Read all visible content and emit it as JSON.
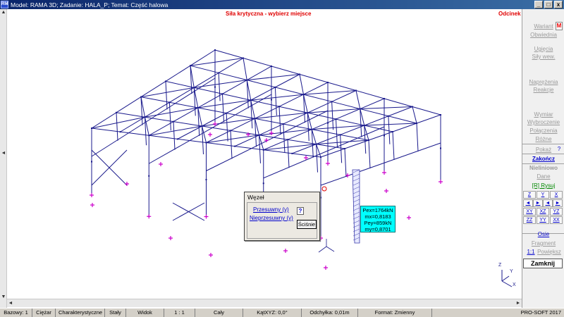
{
  "titlebar": {
    "icon_text": "RM",
    "title": "Model: RAMA 3D; Zadanie: HALA_P; Temat: Część halowa",
    "minimize": "_",
    "maximize": "□",
    "close": "x"
  },
  "canvas": {
    "header_left": "Siła krytyczna - wybierz miejsce",
    "header_right": "Odcinek"
  },
  "right_panel": {
    "wariant": "Wariant",
    "wariant_marker": "M",
    "obwiednia": "Obwiednia",
    "ugiecia": "Ugięcia",
    "sily_wew": "Siły wew.",
    "naprezenia": "Naprężenia",
    "reakcje": "Reakcje",
    "wymiar": "Wymiar",
    "wybroczenie": "Wybroczenie",
    "polaczenia": "Połączenia",
    "rozne": "Różne",
    "pokaz": "Pokaż",
    "help": "?",
    "zakoncz": "Zakończ",
    "nieliniowo": "Nieliniowo",
    "dane": "Dane",
    "rysuj": "[R] Rysuj",
    "grid_row1": [
      "Z",
      "Y",
      "X"
    ],
    "grid_row2": [
      "◄",
      "►",
      "◄",
      "►"
    ],
    "grid_row3": [
      "XY",
      "XZ",
      "YZ"
    ],
    "grid_row4": [
      "ZZ",
      "YY",
      "XX"
    ],
    "osie": "Osie",
    "fragment": "Fragment",
    "scale": "1:1",
    "powieksz": "Powiększ",
    "zamknij": "Zamknij"
  },
  "dialog": {
    "title": "Węzeł",
    "przesuwny": "Przesuwny (y)",
    "nieprzesuwny": "Nieprzesuwny (y)",
    "help": "?",
    "close": "Ściśnie"
  },
  "result": {
    "lines": [
      "Pex=1764kN",
      "mx=0,8183",
      "Pey=859kN",
      "my=0,8701"
    ]
  },
  "axes": {
    "z": "Z",
    "y": "Y",
    "x": "X"
  },
  "statusbar": {
    "cells": [
      "Bazowy: 1",
      "Ciężar",
      "Charakterystyczne",
      "Stały",
      "Widok",
      "1 : 1",
      "Cały",
      "KątXYZ: 0,0°",
      "Odchyłka: 0,01m",
      "Format: Zmienny",
      "PRO-SOFT 2017"
    ]
  },
  "colors": {
    "structure": "#1a1a8c",
    "support": "#cc00cc",
    "highlight": "#e00000",
    "result_bg": "#00ffff"
  }
}
